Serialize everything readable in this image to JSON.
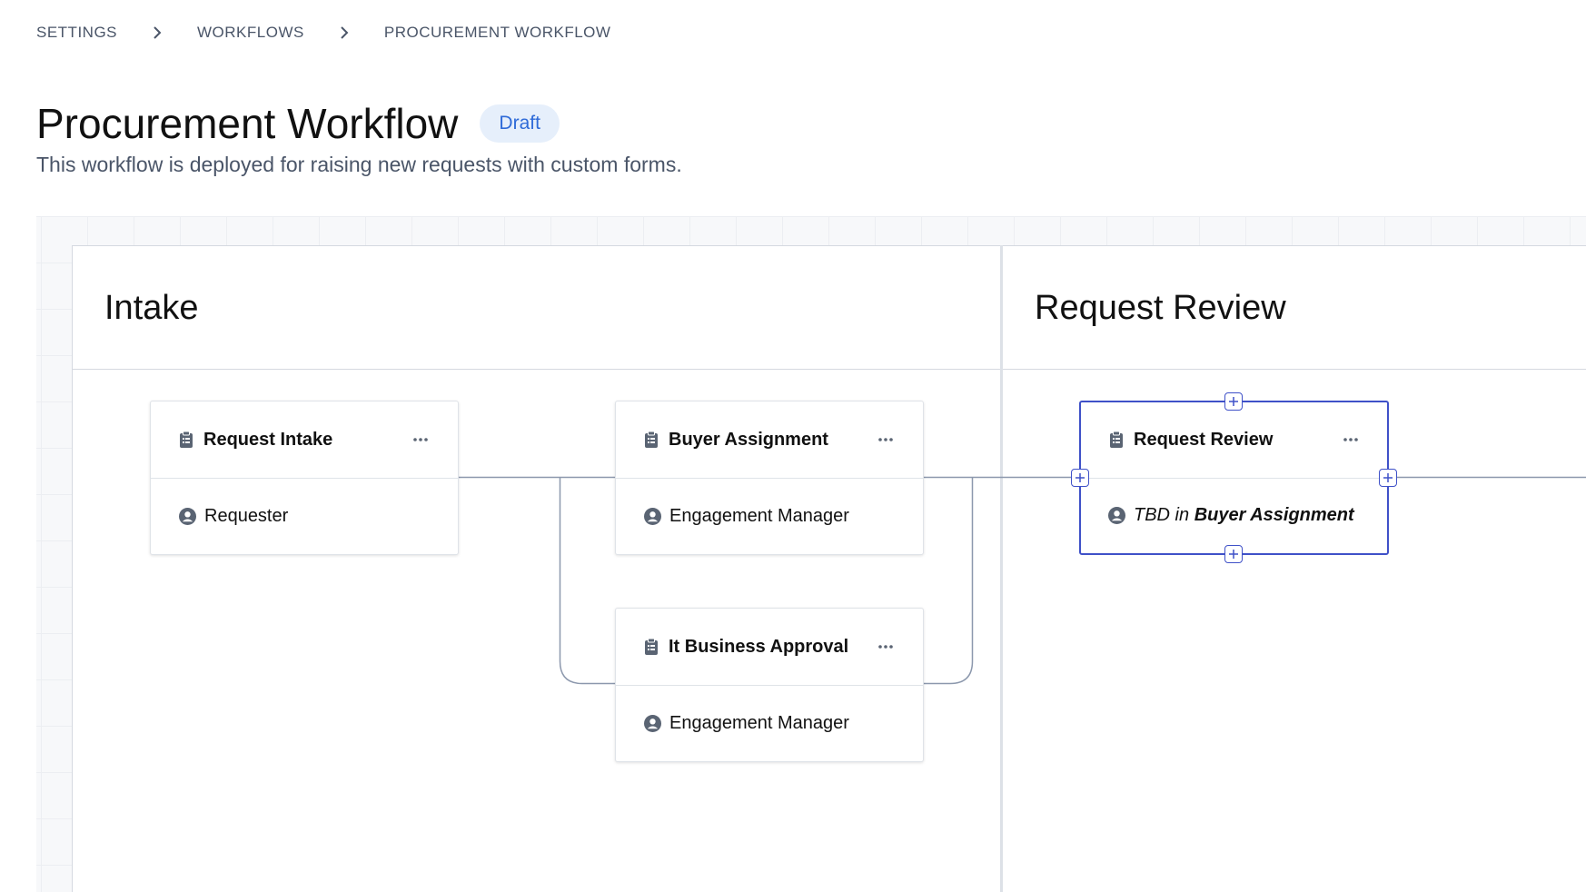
{
  "breadcrumb": {
    "items": [
      "SETTINGS",
      "WORKFLOWS",
      "PROCUREMENT WORKFLOW"
    ]
  },
  "header": {
    "title": "Procurement Workflow",
    "status": "Draft",
    "description": "This workflow is deployed for raising new requests with custom forms."
  },
  "stages": [
    {
      "title": "Intake",
      "steps": [
        {
          "title": "Request Intake",
          "assignee": "Requester"
        },
        {
          "title": "Buyer Assignment",
          "assignee": "Engagement Manager"
        },
        {
          "title": "It Business Approval",
          "assignee": "Engagement Manager"
        }
      ]
    },
    {
      "title": "Request Review",
      "steps": [
        {
          "title": "Request Review",
          "assignee_prefix": "TBD in",
          "assignee_ref": "Buyer Assignment"
        }
      ]
    }
  ],
  "colors": {
    "accent": "#3f51c8",
    "badge_bg": "#e6effb",
    "badge_text": "#2f6bd8",
    "connector": "#8c98ad"
  },
  "icons": {
    "step": "clipboard-icon",
    "assignee": "user-circle-icon",
    "more": "more-horizontal-icon",
    "add": "plus-icon",
    "separator": "chevron-right-icon"
  }
}
